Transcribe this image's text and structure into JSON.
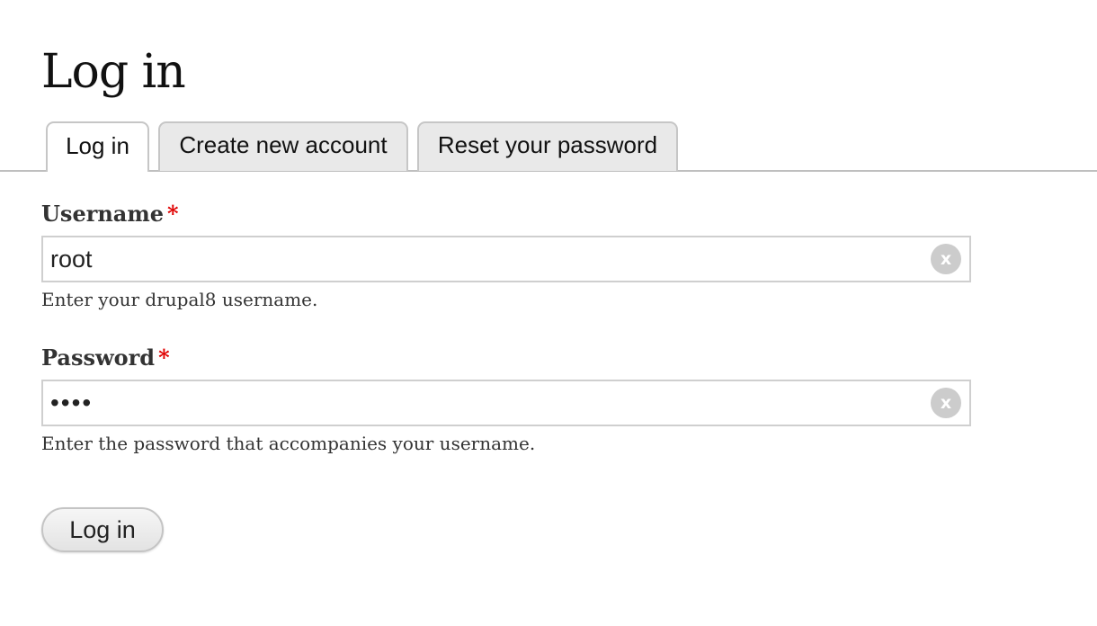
{
  "page": {
    "title": "Log in"
  },
  "tabs": [
    {
      "label": "Log in",
      "active": true
    },
    {
      "label": "Create new account",
      "active": false
    },
    {
      "label": "Reset your password",
      "active": false
    }
  ],
  "form": {
    "username": {
      "label": "Username",
      "required_marker": "*",
      "value": "root",
      "description": "Enter your drupal8 username.",
      "clear_glyph": "x"
    },
    "password": {
      "label": "Password",
      "required_marker": "*",
      "value": "••••",
      "description": "Enter the password that accompanies your username.",
      "clear_glyph": "x"
    },
    "submit_label": "Log in"
  },
  "colors": {
    "required": "#e00000",
    "tab_inactive_bg": "#e9e9e9",
    "border": "#cfcfcf"
  }
}
